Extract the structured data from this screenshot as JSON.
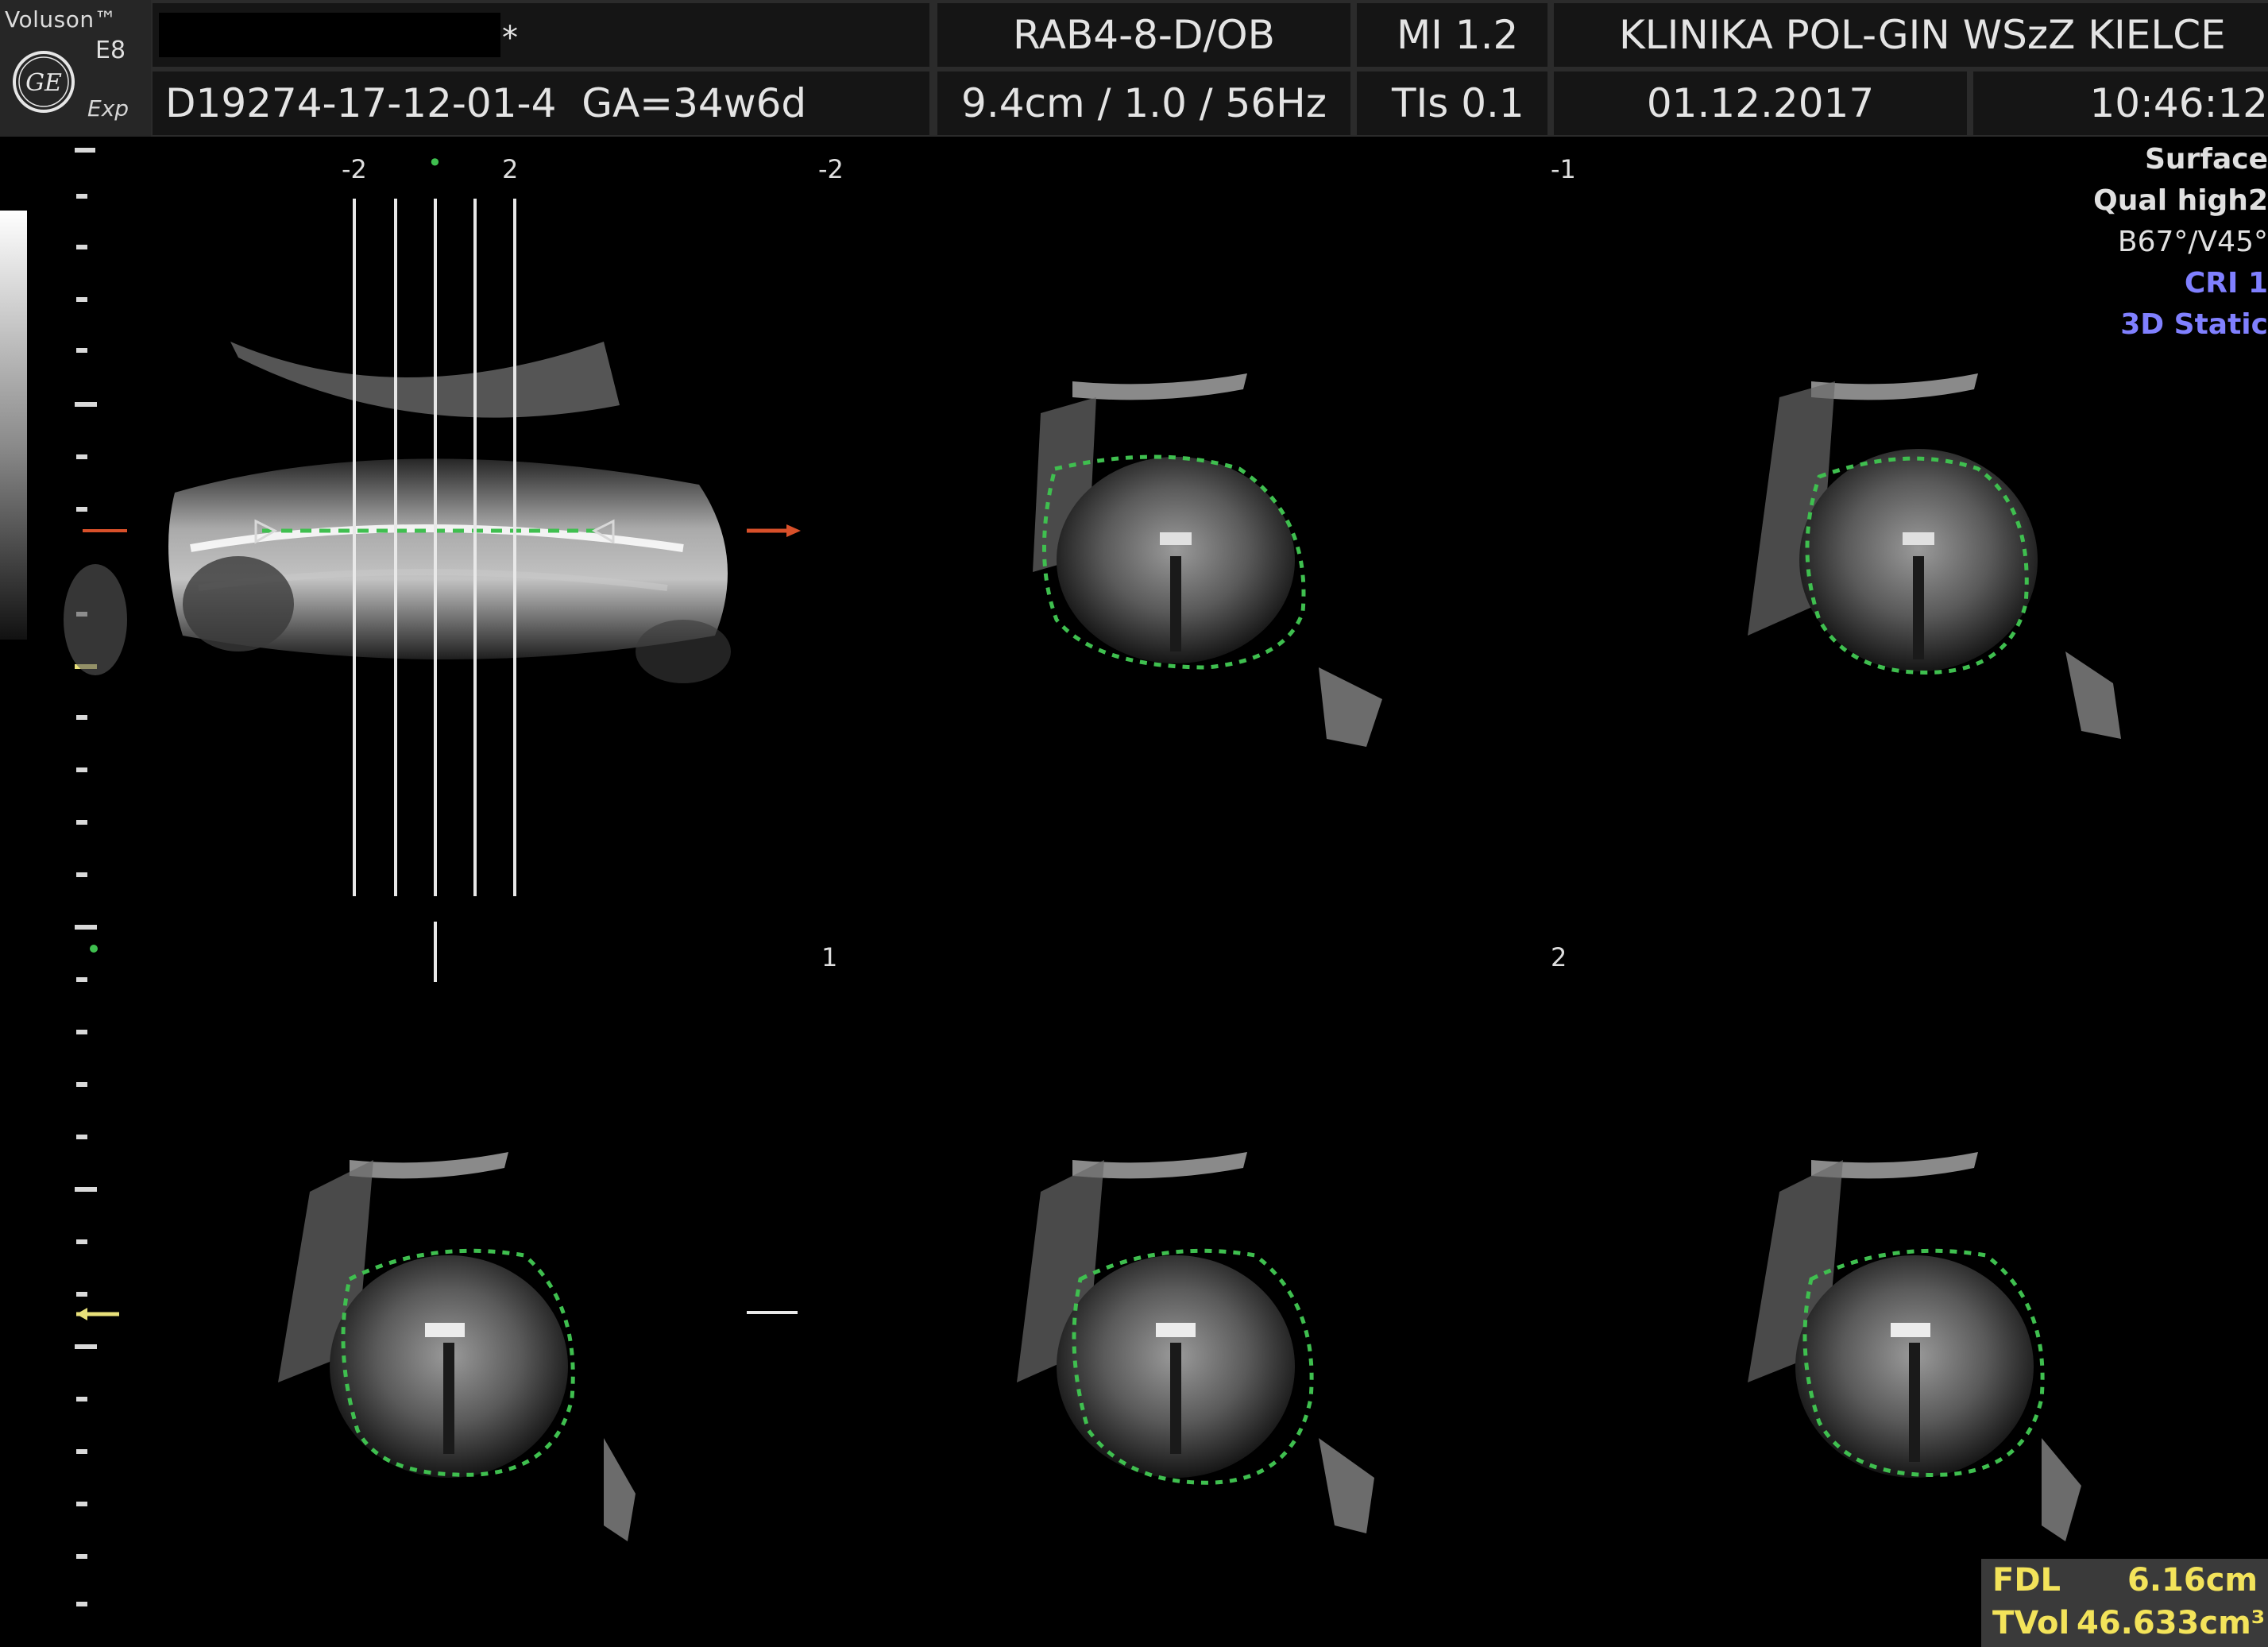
{
  "header": {
    "brand": "Voluson™",
    "model": "E8",
    "edition": "Exp",
    "patient_marker": "*",
    "patient_id": "D19274-17-12-01-4",
    "gestational_age": "GA=34w6d",
    "probe": "RAB4-8-D/OB",
    "imaging_params": "9.4cm / 1.0 / 56Hz",
    "mi": "MI  1.2",
    "tis": "TIs  0.1",
    "institution": "KLINIKA POL-GIN WSzZ KIELCE",
    "date": "01.12.2017",
    "time": "10:46:12"
  },
  "ref_plane": {
    "label_left": "-2",
    "label_dot": "•",
    "label_right": "2"
  },
  "slices": [
    {
      "label": "-2"
    },
    {
      "label": "-1"
    },
    {
      "label": "1"
    },
    {
      "label": "2"
    }
  ],
  "side_info": {
    "render_mode": "Surface",
    "quality": "Qual high2",
    "angles": "B67°/V45°",
    "cri": "CRI 1",
    "acquisition": "3D Static"
  },
  "measurements": {
    "fdl_label": "FDL",
    "fdl_value": "6.16cm",
    "tvol_label": "TVol",
    "tvol_value": "46.633cm³"
  },
  "colors": {
    "background": "#000000",
    "header": "#2b2b2b",
    "contour": "#3fbf4f",
    "blue_text": "#8080ff",
    "measure_text": "#f3e35a",
    "marker_red": "#d8502a",
    "marker_yellow": "#e8e07a"
  },
  "icons": {
    "logo": "ge-logo-icon",
    "left_marker": "arrow-right-icon",
    "right_marker": "arrow-right-icon"
  }
}
